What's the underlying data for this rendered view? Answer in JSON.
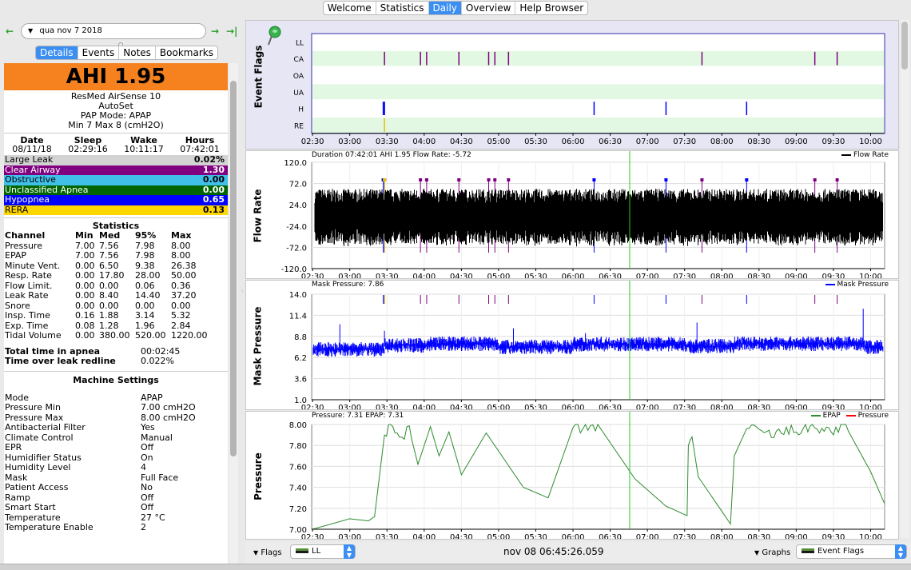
{
  "top_tabs": [
    {
      "label": "Welcome",
      "active": false
    },
    {
      "label": "Statistics",
      "active": false
    },
    {
      "label": "Daily",
      "active": true
    },
    {
      "label": "Overview",
      "active": false
    },
    {
      "label": "Help Browser",
      "active": false
    }
  ],
  "date_bar": {
    "back": "←",
    "forward": "→",
    "last": "→|",
    "date": "qua nov 7 2018",
    "dropdown": "▼"
  },
  "left_tabs": [
    {
      "label": "Details",
      "active": true
    },
    {
      "label": "Events",
      "active": false
    },
    {
      "label": "Notes",
      "active": false
    },
    {
      "label": "Bookmarks",
      "active": false
    }
  ],
  "summary": {
    "ahi": "AHI 1.95",
    "machine": "ResMed AirSense 10",
    "model": "AutoSet",
    "mode": "PAP Mode: APAP",
    "range": "Min 7 Max 8 (cmH2O)"
  },
  "session": {
    "headers": [
      "Date",
      "Sleep",
      "Wake",
      "Hours"
    ],
    "values": [
      "08/11/18",
      "02:29:16",
      "10:11:17",
      "07:42:01"
    ]
  },
  "events": [
    {
      "label": "Large Leak",
      "value": "0.02%",
      "color": "#d3d3d3",
      "text": "#000"
    },
    {
      "label": "Clear Airway",
      "value": "1.30",
      "color": "#800080",
      "text": "#fff"
    },
    {
      "label": "Obstructive",
      "value": "0.00",
      "color": "#40c0e8",
      "text": "#000"
    },
    {
      "label": "Unclassified Apnea",
      "value": "0.00",
      "color": "#006400",
      "text": "#fff"
    },
    {
      "label": "Hypopnea",
      "value": "0.65",
      "color": "#0000ff",
      "text": "#fff"
    },
    {
      "label": "RERA",
      "value": "0.13",
      "color": "#ffd700",
      "text": "#000"
    }
  ],
  "statistics": {
    "title": "Statistics",
    "headers": [
      "Channel",
      "Min",
      "Med",
      "95%",
      "Max"
    ],
    "rows": [
      [
        "Pressure",
        "7.00",
        "7.56",
        "7.98",
        "8.00"
      ],
      [
        "EPAP",
        "7.00",
        "7.56",
        "7.98",
        "8.00"
      ],
      [
        "Minute Vent.",
        "0.00",
        "6.50",
        "9.38",
        "26.38"
      ],
      [
        "Resp. Rate",
        "0.00",
        "17.80",
        "28.00",
        "50.00"
      ],
      [
        "Flow Limit.",
        "0.00",
        "0.00",
        "0.06",
        "0.36"
      ],
      [
        "Leak Rate",
        "0.00",
        "8.40",
        "14.40",
        "37.20"
      ],
      [
        "Snore",
        "0.00",
        "0.00",
        "0.00",
        "0.00"
      ],
      [
        "Insp. Time",
        "0.16",
        "1.88",
        "3.14",
        "5.32"
      ],
      [
        "Exp. Time",
        "0.08",
        "1.28",
        "1.96",
        "2.84"
      ],
      [
        "Tidal Volume",
        "0.00",
        "380.00",
        "520.00",
        "1220.00"
      ]
    ]
  },
  "totals": [
    {
      "label": "Total time in apnea",
      "value": "00:02:45"
    },
    {
      "label": "Time over leak redline",
      "value": "0.022%"
    }
  ],
  "machine_settings": {
    "title": "Machine Settings",
    "rows": [
      [
        "Mode",
        "APAP"
      ],
      [
        "Pressure Min",
        "7.00 cmH2O"
      ],
      [
        "Pressure Max",
        "8.00 cmH2O"
      ],
      [
        "Antibacterial Filter",
        "Yes"
      ],
      [
        "Climate Control",
        "Manual"
      ],
      [
        "EPR",
        "Off"
      ],
      [
        "Humidifier Status",
        "On"
      ],
      [
        "Humidity Level",
        "4"
      ],
      [
        "Mask",
        "Full Face"
      ],
      [
        "Patient Access",
        "No"
      ],
      [
        "Ramp",
        "Off"
      ],
      [
        "Smart Start",
        "Off"
      ],
      [
        "Temperature",
        "27 °C"
      ],
      [
        "Temperature Enable",
        "2"
      ]
    ]
  },
  "graphs": {
    "event_flags": {
      "ylabel": "Event Flags",
      "rows": [
        "LL",
        "CA",
        "OA",
        "UA",
        "H",
        "RE"
      ]
    },
    "flow_rate": {
      "ylabel": "Flow Rate",
      "header": "Duration 07:42:01 AHI 1.95 Flow Rate: -5.72",
      "legend": "Flow Rate"
    },
    "mask_pressure": {
      "ylabel": "Mask Pressure",
      "header": "Mask Pressure: 7.86",
      "legend": "Mask Pressure"
    },
    "pressure": {
      "ylabel": "Pressure",
      "header": "Pressure: 7.31 EPAP: 7.31",
      "legend_epap": "EPAP",
      "legend_pressure": "Pressure"
    }
  },
  "x_ticks": [
    "02:30",
    "03:00",
    "03:30",
    "04:00",
    "04:30",
    "05:00",
    "05:30",
    "06:00",
    "06:30",
    "07:00",
    "07:30",
    "08:00",
    "08:30",
    "09:00",
    "09:30",
    "10:00"
  ],
  "bottom": {
    "flags_label": "Flags",
    "flags_value": "LL",
    "timestamp": "nov 08 06:45:26.059",
    "graphs_label": "Graphs",
    "graphs_value": "Event Flags"
  },
  "chart_data": [
    {
      "type": "scatter",
      "title": "Event Flags",
      "y_categories": [
        "LL",
        "CA",
        "OA",
        "UA",
        "H",
        "RE"
      ],
      "events": [
        {
          "row": "CA",
          "times": [
            "03:28",
            "03:57",
            "04:02",
            "04:28",
            "04:52",
            "04:57",
            "05:08",
            "07:44",
            "09:15",
            "09:33"
          ]
        },
        {
          "row": "H",
          "times": [
            "03:27",
            "03:28",
            "06:17",
            "07:15",
            "08:20"
          ]
        },
        {
          "row": "RE",
          "times": [
            "03:28"
          ]
        }
      ],
      "x_range": [
        "02:29",
        "10:11"
      ]
    },
    {
      "type": "line",
      "title": "Flow Rate",
      "header": "Duration 07:42:01 AHI 1.95 Flow Rate: -5.72",
      "y_ticks": [
        120.0,
        72.0,
        24.0,
        -24.0,
        -72.0,
        -120.0
      ],
      "ylim": [
        -120,
        120
      ],
      "series": [
        {
          "name": "Flow Rate",
          "color": "#000000",
          "envelope": [
            -55,
            55
          ]
        }
      ]
    },
    {
      "type": "line",
      "title": "Mask Pressure",
      "header": "Mask Pressure: 7.86",
      "y_ticks": [
        14.0,
        11.4,
        8.8,
        6.2,
        3.6,
        1.0
      ],
      "ylim": [
        1,
        14
      ],
      "series": [
        {
          "name": "Mask Pressure",
          "color": "#0000ff"
        }
      ]
    },
    {
      "type": "line",
      "title": "Pressure",
      "header": "Pressure: 7.31 EPAP: 7.31",
      "y_ticks": [
        8.0,
        7.8,
        7.6,
        7.4,
        7.2,
        7.0
      ],
      "ylim": [
        7,
        8
      ],
      "series": [
        {
          "name": "EPAP",
          "color": "#2e8b2e",
          "points": [
            [
              "02:30",
              7.0
            ],
            [
              "02:45",
              7.05
            ],
            [
              "03:00",
              7.1
            ],
            [
              "03:15",
              7.08
            ],
            [
              "03:20",
              7.12
            ],
            [
              "03:28",
              7.9
            ],
            [
              "03:33",
              8.0
            ],
            [
              "03:40",
              7.85
            ],
            [
              "03:48",
              7.95
            ],
            [
              "03:55",
              7.62
            ],
            [
              "04:05",
              7.98
            ],
            [
              "04:12",
              7.7
            ],
            [
              "04:20",
              7.93
            ],
            [
              "04:30",
              7.52
            ],
            [
              "04:50",
              7.92
            ],
            [
              "05:20",
              7.4
            ],
            [
              "05:40",
              7.3
            ],
            [
              "06:00",
              7.97
            ],
            [
              "06:10",
              7.95
            ],
            [
              "06:20",
              8.0
            ],
            [
              "06:50",
              7.48
            ],
            [
              "07:15",
              7.22
            ],
            [
              "07:32",
              7.13
            ],
            [
              "07:33",
              7.8
            ],
            [
              "07:36",
              7.88
            ],
            [
              "07:41",
              7.5
            ],
            [
              "08:03",
              7.12
            ],
            [
              "08:07",
              7.05
            ],
            [
              "08:10",
              7.7
            ],
            [
              "08:20",
              7.96
            ],
            [
              "08:40",
              7.9
            ],
            [
              "09:00",
              7.95
            ],
            [
              "09:15",
              7.97
            ],
            [
              "09:30",
              7.94
            ],
            [
              "09:40",
              7.98
            ],
            [
              "10:00",
              7.55
            ],
            [
              "10:11",
              7.25
            ]
          ]
        },
        {
          "name": "Pressure",
          "color": "#ff0000"
        }
      ]
    }
  ]
}
